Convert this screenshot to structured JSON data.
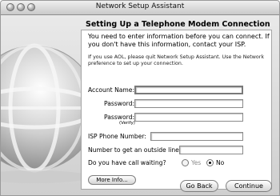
{
  "window": {
    "title": "Network Setup Assistant"
  },
  "heading": "Setting Up a Telephone Modem Connection",
  "intro": "You need to enter information before you can connect. If you don't have this information, contact your ISP.",
  "aol_note": "If you use AOL, please quit Network Setup Assistant. Use the Network preference to set up your connection.",
  "form": {
    "account_name": {
      "label": "Account Name:",
      "value": ""
    },
    "password": {
      "label": "Password:",
      "value": ""
    },
    "password_verify": {
      "label": "Password:",
      "sublabel": "(Verify)",
      "value": ""
    },
    "isp_phone": {
      "label": "ISP Phone Number:",
      "value": ""
    },
    "outside_line": {
      "label": "Number to get an outside line:",
      "value": ""
    },
    "call_waiting": {
      "label": "Do you have call waiting?",
      "options": [
        "Yes",
        "No"
      ],
      "selected": "No"
    }
  },
  "buttons": {
    "more_info": "More Info...",
    "go_back": "Go Back",
    "continue": "Continue"
  }
}
